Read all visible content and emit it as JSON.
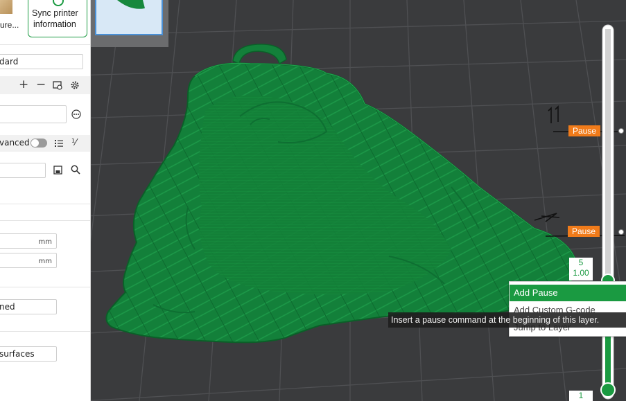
{
  "toolbar": {
    "texture_label": "ure...",
    "sync_line1": "Sync printer",
    "sync_line2": "information"
  },
  "left_panel": {
    "profile_value": "dard",
    "advanced_label": "vanced",
    "fields": {
      "mm_unit_1": "mm",
      "mm_unit_2": "mm",
      "pattern_value": "ned",
      "surface_value": "surfaces"
    }
  },
  "viewport": {
    "handwritten_upper": "11",
    "handwritten_lower": "7",
    "pause_label": "Pause"
  },
  "layer_slider": {
    "current_layer": "5",
    "current_height": "1.00",
    "bottom_layer": "1",
    "accent_color": "#1a9a41"
  },
  "context_menu": {
    "items": [
      "Add Pause",
      "Add Custom G-code",
      "Jump to Layer"
    ]
  },
  "tooltip": {
    "text": "Insert a pause command at the beginning of this layer."
  },
  "colors": {
    "model_green": "#13803a",
    "pause_orange": "#f07b1a",
    "menu_highlight": "#1a9a41"
  }
}
